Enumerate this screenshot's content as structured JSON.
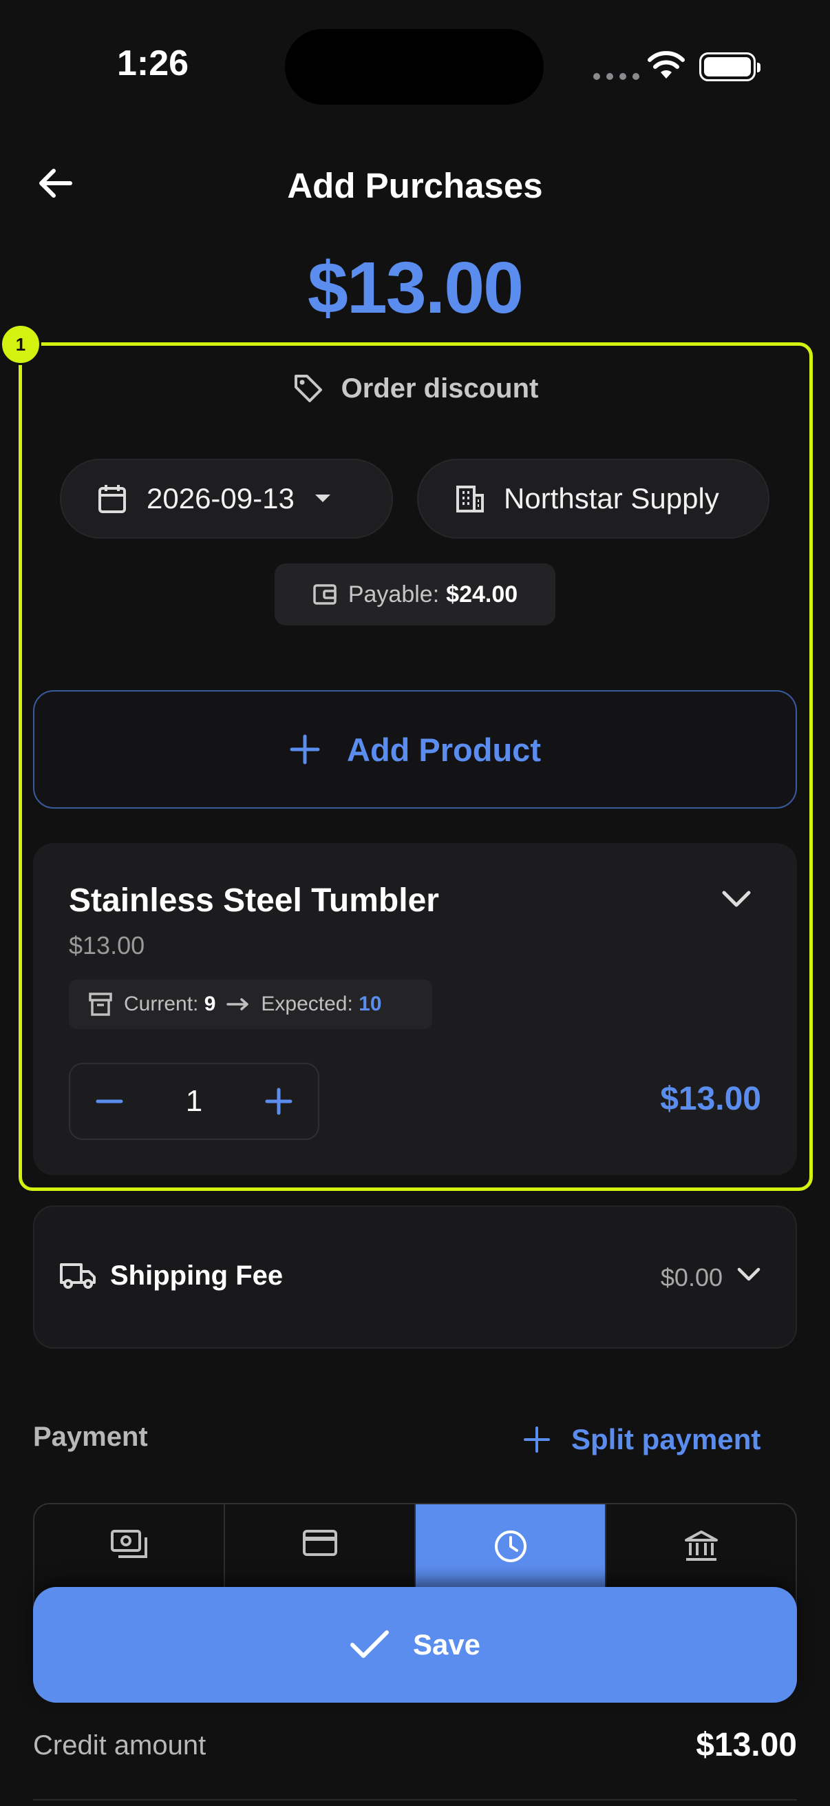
{
  "status": {
    "time": "1:26"
  },
  "header": {
    "title": "Add Purchases",
    "back_icon": "arrow-left-icon"
  },
  "total": "$13.00",
  "highlight": {
    "badge": "1",
    "color": "#d4f20f"
  },
  "order": {
    "discount_label": "Order discount",
    "date": "2026-09-13",
    "vendor": "Northstar Supply",
    "payable_label": "Payable:",
    "payable_value": "$24.00"
  },
  "add_product": {
    "label": "Add Product"
  },
  "product": {
    "name": "Stainless Steel Tumbler",
    "price": "$13.00",
    "current_label": "Current:",
    "current_value": "9",
    "expected_label": "Expected:",
    "expected_value": "10",
    "quantity": "1",
    "line_total": "$13.00"
  },
  "shipping": {
    "label": "Shipping Fee",
    "value": "$0.00"
  },
  "payment": {
    "label": "Payment",
    "split_label": "Split payment",
    "methods": [
      {
        "icon": "cash-icon",
        "active": false
      },
      {
        "icon": "card-icon",
        "active": false
      },
      {
        "icon": "clock-icon",
        "active": true
      },
      {
        "icon": "bank-icon",
        "active": false
      }
    ]
  },
  "save": {
    "label": "Save"
  },
  "credit": {
    "label": "Credit amount",
    "value": "$13.00"
  },
  "colors": {
    "accent": "#5b8def",
    "background": "#111112",
    "card": "#1c1c1e"
  }
}
